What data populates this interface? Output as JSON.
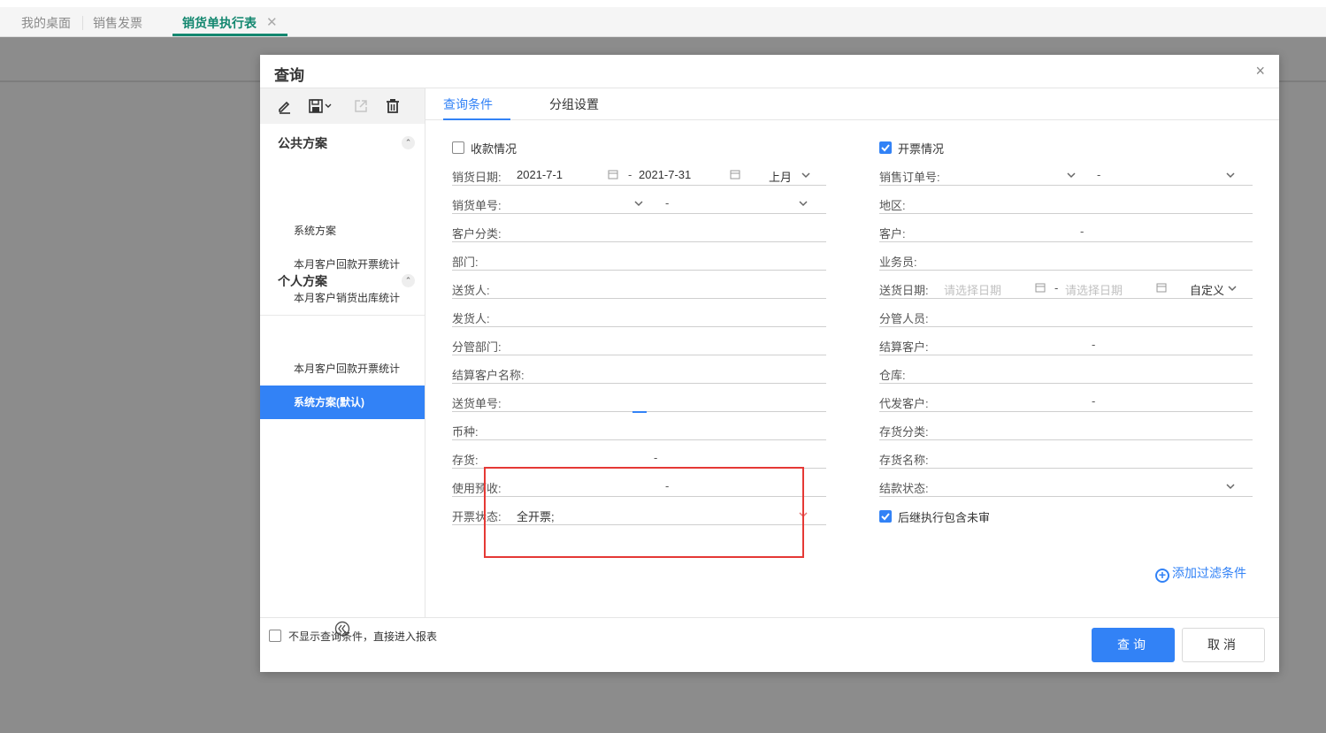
{
  "tabs": [
    {
      "label": "我的桌面"
    },
    {
      "label": "销售发票"
    },
    {
      "label": "销货单执行表",
      "close": "✕"
    }
  ],
  "dialog": {
    "title": "查询",
    "close": "×",
    "sidebar": {
      "public_group": "公共方案",
      "public_items": [
        "系统方案",
        "本月客户回款开票统计",
        "本月客户销货出库统计"
      ],
      "personal_group": "个人方案",
      "personal_items": [
        "本月客户回款开票统计",
        "系统方案(默认)"
      ]
    },
    "inner_tabs": [
      "查询条件",
      "分组设置"
    ],
    "left_fields": {
      "collect_label": "收款情况",
      "sale_date": {
        "label": "销货日期:",
        "from": "2021-7-1",
        "dash": "-",
        "to": "2021-7-31",
        "preset": "上月"
      },
      "sale_no": {
        "label": "销货单号:",
        "dash": "-"
      },
      "customer_class": "客户分类:",
      "department": "部门:",
      "deliverer": "送货人:",
      "sender": "发货人:",
      "managed_dept": "分管部门:",
      "settle_customer_name": "结算客户名称:",
      "delivery_no": "送货单号:",
      "currency": "币种:",
      "inventory": {
        "label": "存货:",
        "dash": "-"
      },
      "prepay": {
        "label": "使用预收:",
        "dash": "-"
      },
      "invoice_status": {
        "label": "开票状态:",
        "value": "全开票;"
      }
    },
    "right_fields": {
      "invoice_label": "开票情况",
      "sales_order_no": {
        "label": "销售订单号:",
        "dash": "-"
      },
      "region": "地区:",
      "customer": {
        "label": "客户:",
        "dash": "-"
      },
      "salesman": "业务员:",
      "delivery_date": {
        "label": "送货日期:",
        "from_ph": "请选择日期",
        "dash": "-",
        "to_ph": "请选择日期",
        "preset": "自定义"
      },
      "manager": "分管人员:",
      "settle_customer": {
        "label": "结算客户:",
        "dash": "-"
      },
      "warehouse": "仓库:",
      "agent_customer": {
        "label": "代发客户:",
        "dash": "-"
      },
      "inventory_class": "存货分类:",
      "inventory_name": "存货名称:",
      "settle_status": "结款状态:",
      "include_unaudited": "后继执行包含未审"
    },
    "add_filter": "添加过滤条件",
    "skip_label": "不显示查询条件，直接进入报表",
    "query_btn": "查询",
    "cancel_btn": "取消"
  }
}
